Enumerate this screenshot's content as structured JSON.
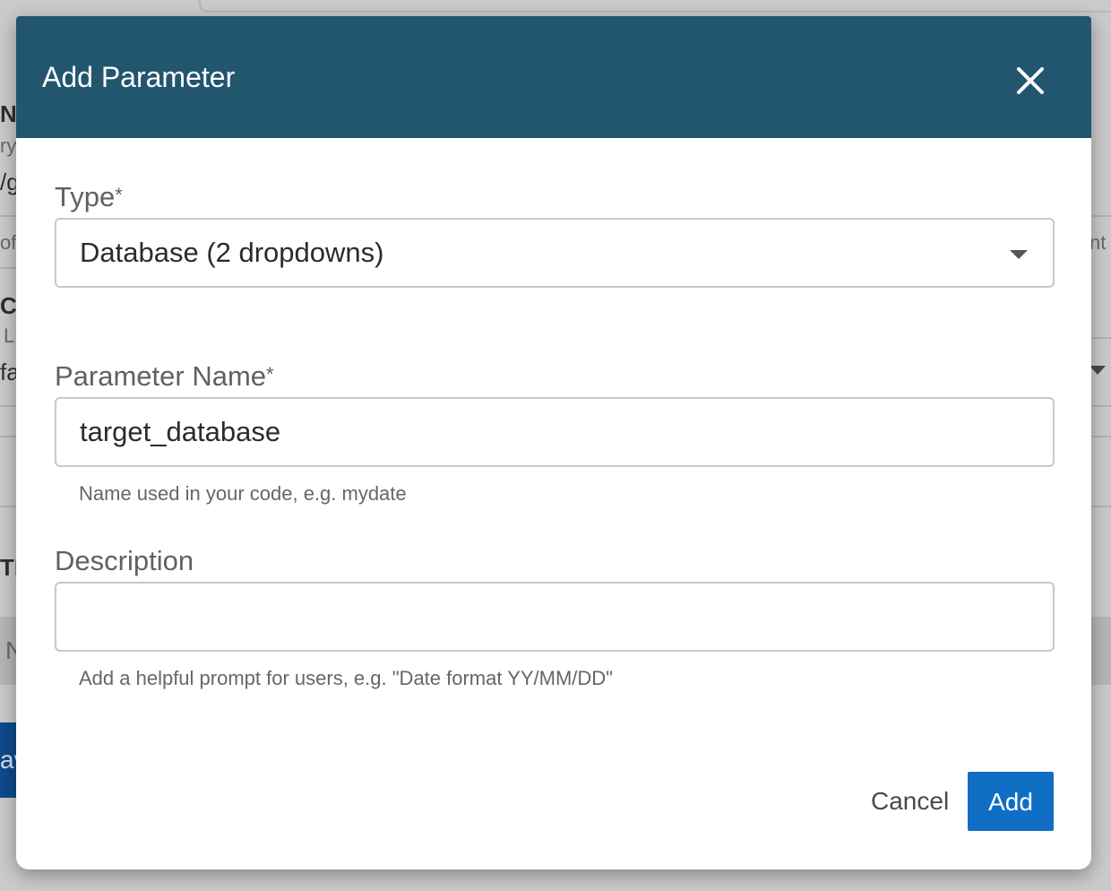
{
  "background": {
    "fragments": [
      "N",
      "ry",
      "/g",
      "of",
      "nt",
      "CE",
      "L",
      "fa",
      "TE",
      "N",
      "av"
    ]
  },
  "modal": {
    "title": "Add Parameter",
    "close_icon": "close-icon",
    "fields": {
      "type": {
        "label": "Type",
        "required_mark": "*",
        "value": "Database (2 dropdowns)",
        "caret_icon": "caret-down-icon"
      },
      "parameter_name": {
        "label": "Parameter Name",
        "required_mark": "*",
        "value": "target_database",
        "helper": "Name used in your code, e.g. mydate"
      },
      "description": {
        "label": "Description",
        "value": "",
        "helper": "Add a helpful prompt for users, e.g. \"Date format YY/MM/DD\""
      }
    },
    "actions": {
      "cancel_label": "Cancel",
      "add_label": "Add"
    }
  },
  "colors": {
    "header_bg": "#22566f",
    "primary_button": "#0f6ec4",
    "overlay": "#cbcbcb"
  }
}
